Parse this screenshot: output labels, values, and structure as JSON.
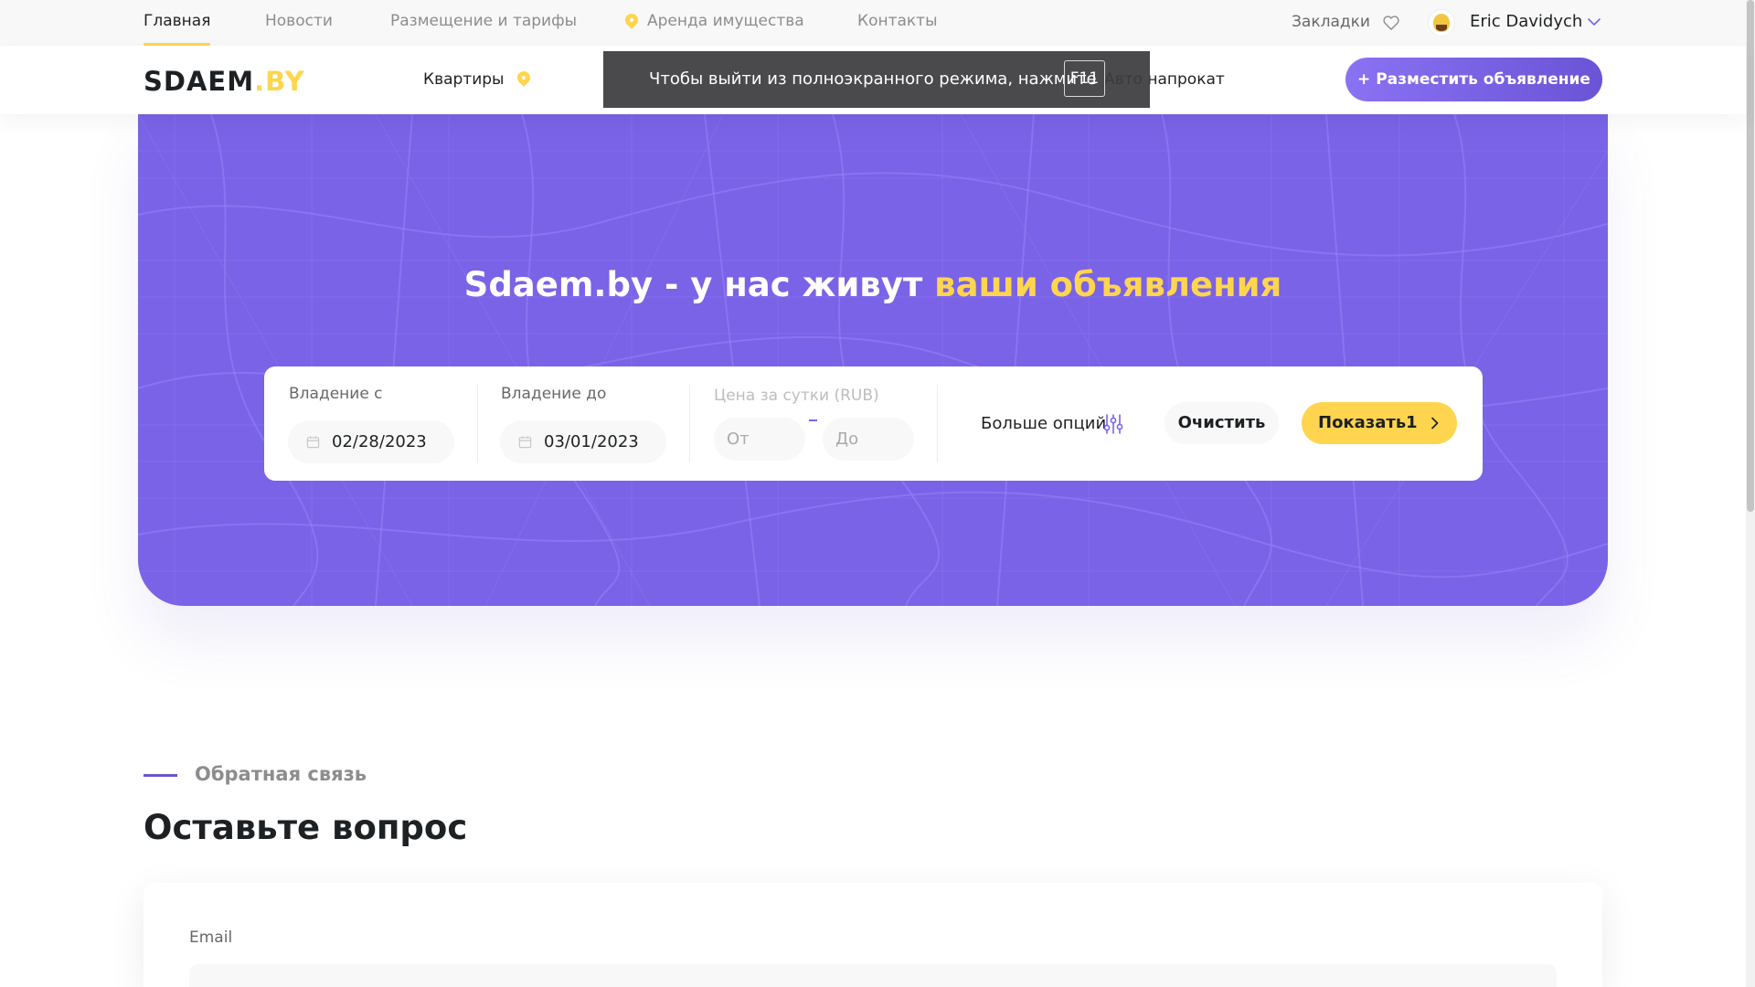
{
  "topnav": {
    "links": [
      {
        "label": "Главная",
        "active": true
      },
      {
        "label": "Новости"
      },
      {
        "label": "Размещение и тарифы"
      },
      {
        "label": "Аренда имущества",
        "icon": "location-pin-icon"
      },
      {
        "label": "Контакты"
      }
    ],
    "bookmarks_label": "Закладки",
    "bookmarks_icon": "heart-icon",
    "user_name": "Eric Davidych",
    "user_icon": "chevron-down-icon"
  },
  "header": {
    "logo_main": "SDAEM",
    "logo_dot": ".",
    "logo_suffix": "BY",
    "categories": [
      {
        "label": "Квартиры",
        "icon": "location-pin-icon"
      },
      {
        "label": "Авто напрокат"
      }
    ],
    "post_button": "+ Разместить объявление"
  },
  "fullscreen_notice": {
    "message": "Чтобы выйти из полноэкранного режима, нажмите",
    "key": "F11"
  },
  "hero": {
    "title_main": "Sdaem.by - у нас живут ",
    "title_accent": "ваши объявления"
  },
  "search": {
    "from_label": "Владение с",
    "from_value": "02/28/2023",
    "to_label": "Владение до",
    "to_value": "03/01/2023",
    "price_label": "Цена за сутки (RUB)",
    "price_from_placeholder": "От",
    "price_to_placeholder": "До",
    "more_options": "Больше опций",
    "clear": "Очистить",
    "show": "Показать",
    "show_count": "1"
  },
  "feedback": {
    "eyebrow": "Обратная связь",
    "title": "Оставьте вопрос",
    "email_label": "Email"
  },
  "colors": {
    "accent_purple": "#7a63e6",
    "accent_yellow": "#ffd54f",
    "text_dark": "#1e2123",
    "text_muted": "#8d8d8d"
  }
}
